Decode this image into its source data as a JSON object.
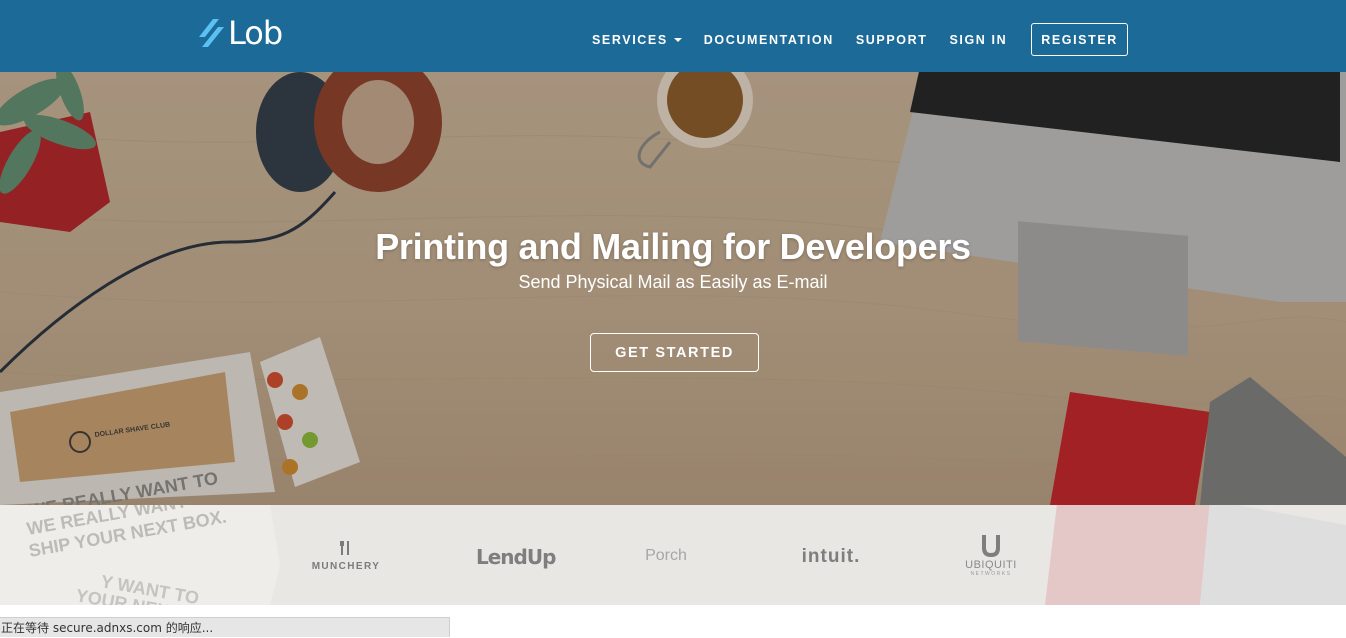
{
  "header": {
    "brand": "Lob",
    "nav": [
      {
        "label": "SERVICES",
        "dropdown": true
      },
      {
        "label": "DOCUMENTATION"
      },
      {
        "label": "SUPPORT"
      },
      {
        "label": "SIGN IN"
      }
    ],
    "register_label": "REGISTER"
  },
  "hero": {
    "title": "Printing and Mailing for Developers",
    "subtitle": "Send Physical Mail as Easily as E-mail",
    "cta_label": "GET STARTED",
    "photo_text": {
      "box_brand": "DOLLAR SHAVE CLUB",
      "box_line1": "WE REALLY WANT TO",
      "box_line2": "SHIP YOUR NEXT BOX."
    }
  },
  "clients": {
    "logos": [
      "MUNCHERY",
      "LendUp",
      "Porch",
      "intuit.",
      "UBIQUITI"
    ],
    "ubiquiti_sub": "NETWORKS",
    "faded_line1": "WE REALLY WANT TO",
    "faded_line2": "SHIP YOUR NEXT BOX.",
    "faded_line3": "Y WANT TO",
    "faded_line4": "YOUR NEXT B"
  },
  "status_bar": "正在等待 secure.adnxs.com 的响应...",
  "colors": {
    "nav_bg": "#1b6a98",
    "logo_accent": "#5bc0f2"
  }
}
